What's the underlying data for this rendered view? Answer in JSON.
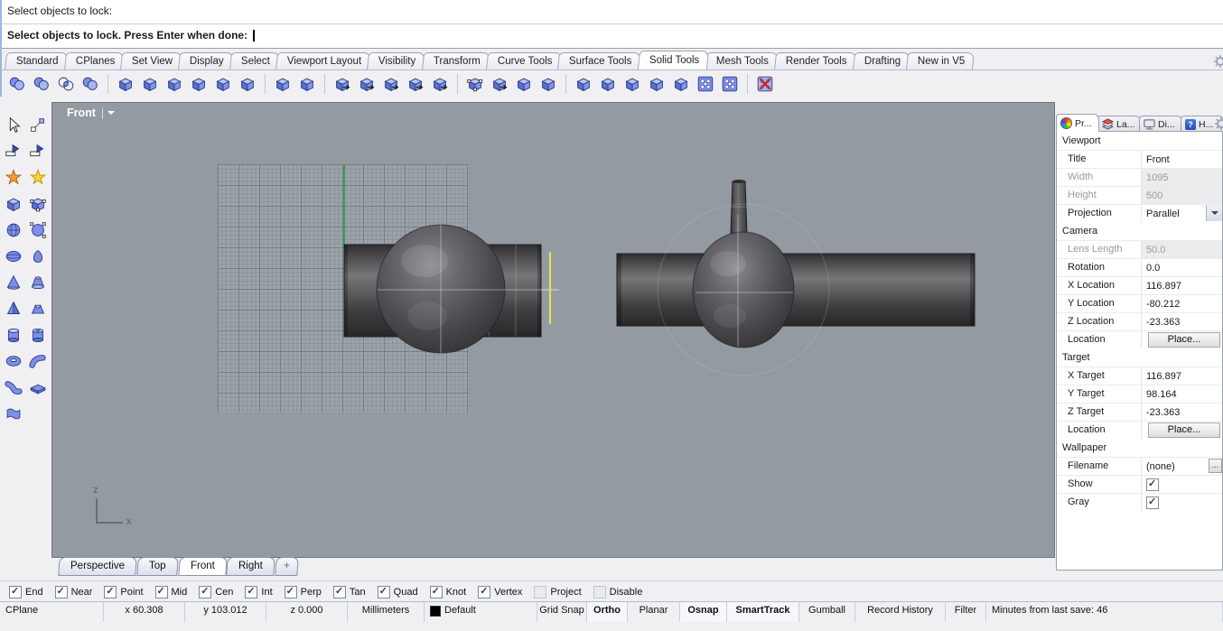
{
  "command": {
    "history": "Select objects to lock:",
    "prompt": "Select objects to lock. Press Enter when done:"
  },
  "menubar": {
    "active": "Solid Tools",
    "tabs": [
      "Standard",
      "CPlanes",
      "Set View",
      "Display",
      "Select",
      "Viewport Layout",
      "Visibility",
      "Transform",
      "Curve Tools",
      "Surface Tools",
      "Solid Tools",
      "Mesh Tools",
      "Render Tools",
      "Drafting",
      "New in V5"
    ]
  },
  "toolbar": {
    "dividers": [
      4,
      10,
      12,
      17,
      21,
      28
    ],
    "icons": [
      {
        "name": "boolean-union",
        "type": "spheres"
      },
      {
        "name": "boolean-difference",
        "type": "spheres"
      },
      {
        "name": "boolean-intersection",
        "type": "spheresO"
      },
      {
        "name": "boolean-two-objects",
        "type": "spheres"
      },
      {
        "name": "extrude-planar-curve",
        "type": "cube"
      },
      {
        "name": "polyhedron",
        "type": "cube"
      },
      {
        "name": "split-solid",
        "type": "cube"
      },
      {
        "name": "cap-planar-holes",
        "type": "cube"
      },
      {
        "name": "extract-surface",
        "type": "cube"
      },
      {
        "name": "create-solid",
        "type": "cube"
      },
      {
        "name": "box",
        "type": "cube"
      },
      {
        "name": "box-diagonal",
        "type": "cube"
      },
      {
        "name": "slab",
        "type": "cubeA"
      },
      {
        "name": "extrude-surface",
        "type": "cubeA"
      },
      {
        "name": "extrude-surface-along-curve",
        "type": "cubeA"
      },
      {
        "name": "extrude-both-sides",
        "type": "cubeA"
      },
      {
        "name": "extrude-to-boundary",
        "type": "cubeA"
      },
      {
        "name": "solid-points-on",
        "type": "cubeP"
      },
      {
        "name": "move-face",
        "type": "cubeA"
      },
      {
        "name": "shear-solid",
        "type": "cube"
      },
      {
        "name": "rotate-face",
        "type": "cube"
      },
      {
        "name": "round-hole",
        "type": "cube"
      },
      {
        "name": "place-hole",
        "type": "cube"
      },
      {
        "name": "wedge",
        "type": "cube"
      },
      {
        "name": "move-hole",
        "type": "cube"
      },
      {
        "name": "copy-hole",
        "type": "cube"
      },
      {
        "name": "array-hole-polar",
        "type": "grid"
      },
      {
        "name": "array-hole",
        "type": "grid"
      },
      {
        "name": "delete-hole",
        "type": "gridx"
      }
    ]
  },
  "sidebar": {
    "tools": [
      {
        "name": "select-pointer",
        "glyph": "pointer"
      },
      {
        "name": "control-points-on",
        "glyph": "points"
      },
      {
        "name": "hide-objects",
        "glyph": "flag"
      },
      {
        "name": "show-objects",
        "glyph": "flag"
      },
      {
        "name": "explode",
        "glyph": "star-orange"
      },
      {
        "name": "smash",
        "glyph": "star-yellow"
      },
      {
        "name": "box",
        "glyph": "cube"
      },
      {
        "name": "box-3-point",
        "glyph": "cube-pts"
      },
      {
        "name": "sphere",
        "glyph": "sphere"
      },
      {
        "name": "sphere-fit-points",
        "glyph": "sphere-pts"
      },
      {
        "name": "ellipsoid",
        "glyph": "ellipsoid"
      },
      {
        "name": "paraboloid",
        "glyph": "parab"
      },
      {
        "name": "cone",
        "glyph": "cone"
      },
      {
        "name": "truncated-cone",
        "glyph": "tcone"
      },
      {
        "name": "pyramid",
        "glyph": "pyramid"
      },
      {
        "name": "truncated-pyramid",
        "glyph": "tpyr"
      },
      {
        "name": "cylinder",
        "glyph": "cylinder"
      },
      {
        "name": "tube",
        "glyph": "tube"
      },
      {
        "name": "torus",
        "glyph": "torus"
      },
      {
        "name": "pipe",
        "glyph": "pipe"
      },
      {
        "name": "pipe-flat-caps",
        "glyph": "pipe2"
      },
      {
        "name": "slab",
        "glyph": "slab"
      },
      {
        "name": "drape-surface",
        "glyph": "drape"
      }
    ]
  },
  "viewport": {
    "title": "Front",
    "axis": {
      "z": "z",
      "x": "x"
    }
  },
  "panel": {
    "tabs": [
      {
        "label": "Pr...",
        "icon": "properties",
        "active": true
      },
      {
        "label": "La...",
        "icon": "layers",
        "active": false
      },
      {
        "label": "Di...",
        "icon": "display",
        "active": false
      },
      {
        "label": "H...",
        "icon": "help",
        "active": false
      }
    ],
    "sections": [
      {
        "title": "Viewport",
        "rows": [
          {
            "label": "Title",
            "value": "Front",
            "kind": "text"
          },
          {
            "label": "Width",
            "value": "1095",
            "kind": "disabled"
          },
          {
            "label": "Height",
            "value": "500",
            "kind": "disabled"
          },
          {
            "label": "Projection",
            "value": "Parallel",
            "kind": "select"
          }
        ]
      },
      {
        "title": "Camera",
        "rows": [
          {
            "label": "Lens Length",
            "value": "50.0",
            "kind": "disabled"
          },
          {
            "label": "Rotation",
            "value": "0.0",
            "kind": "text"
          },
          {
            "label": "X Location",
            "value": "116.897",
            "kind": "text"
          },
          {
            "label": "Y Location",
            "value": "-80.212",
            "kind": "text"
          },
          {
            "label": "Z Location",
            "value": "-23.363",
            "kind": "text"
          },
          {
            "label": "Location",
            "value": "Place...",
            "kind": "button"
          }
        ]
      },
      {
        "title": "Target",
        "rows": [
          {
            "label": "X Target",
            "value": "116.897",
            "kind": "text"
          },
          {
            "label": "Y Target",
            "value": "98.164",
            "kind": "text"
          },
          {
            "label": "Z Target",
            "value": "-23.363",
            "kind": "text"
          },
          {
            "label": "Location",
            "value": "Place...",
            "kind": "button"
          }
        ]
      },
      {
        "title": "Wallpaper",
        "rows": [
          {
            "label": "Filename",
            "value": "(none)",
            "more": "...",
            "kind": "file"
          },
          {
            "label": "Show",
            "checked": true,
            "kind": "check"
          },
          {
            "label": "Gray",
            "checked": true,
            "kind": "check"
          }
        ]
      }
    ]
  },
  "viewport_tabs": {
    "items": [
      "Perspective",
      "Top",
      "Front",
      "Right"
    ],
    "active": "Front",
    "add_label": "+"
  },
  "osnap": {
    "items": [
      {
        "label": "End",
        "checked": true
      },
      {
        "label": "Near",
        "checked": true
      },
      {
        "label": "Point",
        "checked": true
      },
      {
        "label": "Mid",
        "checked": true
      },
      {
        "label": "Cen",
        "checked": true
      },
      {
        "label": "Int",
        "checked": true
      },
      {
        "label": "Perp",
        "checked": true
      },
      {
        "label": "Tan",
        "checked": true
      },
      {
        "label": "Quad",
        "checked": true
      },
      {
        "label": "Knot",
        "checked": true
      },
      {
        "label": "Vertex",
        "checked": true
      },
      {
        "label": "Project",
        "checked": false
      },
      {
        "label": "Disable",
        "checked": false
      }
    ]
  },
  "statusbar": {
    "items": [
      {
        "label": "CPlane"
      },
      {
        "label": "x 60.308"
      },
      {
        "label": "y 103.012"
      },
      {
        "label": "z 0.000"
      },
      {
        "label": "Millimeters"
      },
      {
        "label": "Default",
        "swatch": true
      },
      {
        "label": "Grid Snap"
      },
      {
        "label": "Ortho",
        "bold": true
      },
      {
        "label": "Planar"
      },
      {
        "label": "Osnap",
        "bold": true
      },
      {
        "label": "SmartTrack",
        "bold": true
      },
      {
        "label": "Gumball"
      },
      {
        "label": "Record History"
      },
      {
        "label": "Filter"
      },
      {
        "label": "Minutes from last save: 46"
      }
    ]
  }
}
